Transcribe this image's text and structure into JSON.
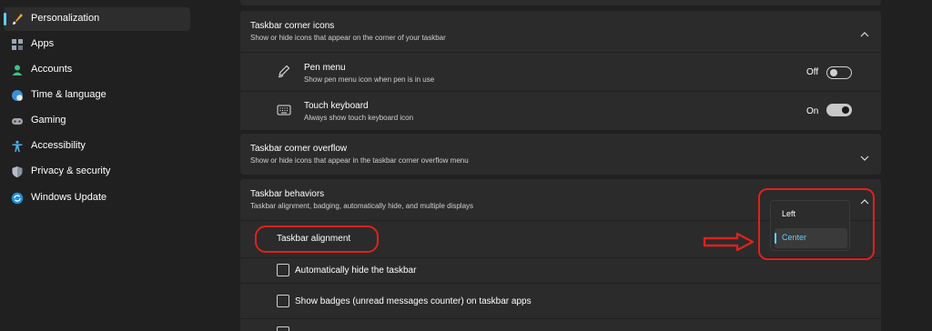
{
  "sidebar": {
    "items": [
      {
        "label": "Personalization",
        "icon": "paintbrush-icon",
        "selected": true
      },
      {
        "label": "Apps",
        "icon": "apps-icon",
        "selected": false
      },
      {
        "label": "Accounts",
        "icon": "person-icon",
        "selected": false
      },
      {
        "label": "Time & language",
        "icon": "globe-clock-icon",
        "selected": false
      },
      {
        "label": "Gaming",
        "icon": "gamepad-icon",
        "selected": false
      },
      {
        "label": "Accessibility",
        "icon": "accessibility-icon",
        "selected": false
      },
      {
        "label": "Privacy & security",
        "icon": "shield-icon",
        "selected": false
      },
      {
        "label": "Windows Update",
        "icon": "update-icon",
        "selected": false
      }
    ]
  },
  "corner_icons": {
    "title": "Taskbar corner icons",
    "subtitle": "Show or hide icons that appear on the corner of your taskbar",
    "expanded": true,
    "pen_menu": {
      "title": "Pen menu",
      "subtitle": "Show pen menu icon when pen is in use",
      "state_label": "Off",
      "on": false
    },
    "touch_keyboard": {
      "title": "Touch keyboard",
      "subtitle": "Always show touch keyboard icon",
      "state_label": "On",
      "on": true
    }
  },
  "corner_overflow": {
    "title": "Taskbar corner overflow",
    "subtitle": "Show or hide icons that appear in the taskbar corner overflow menu",
    "expanded": false
  },
  "behaviors": {
    "title": "Taskbar behaviors",
    "subtitle": "Taskbar alignment, badging, automatically hide, and multiple displays",
    "expanded": true,
    "alignment_label": "Taskbar alignment",
    "alignment_options": [
      "Left",
      "Center"
    ],
    "alignment_selected": "Center",
    "auto_hide_label": "Automatically hide the taskbar",
    "auto_hide_checked": false,
    "badges_label": "Show badges (unread messages counter) on taskbar apps",
    "badges_checked": false
  },
  "colors": {
    "accent": "#60cdff",
    "annotation": "#e0211c",
    "background": "#202020",
    "card": "#2b2b2b"
  }
}
